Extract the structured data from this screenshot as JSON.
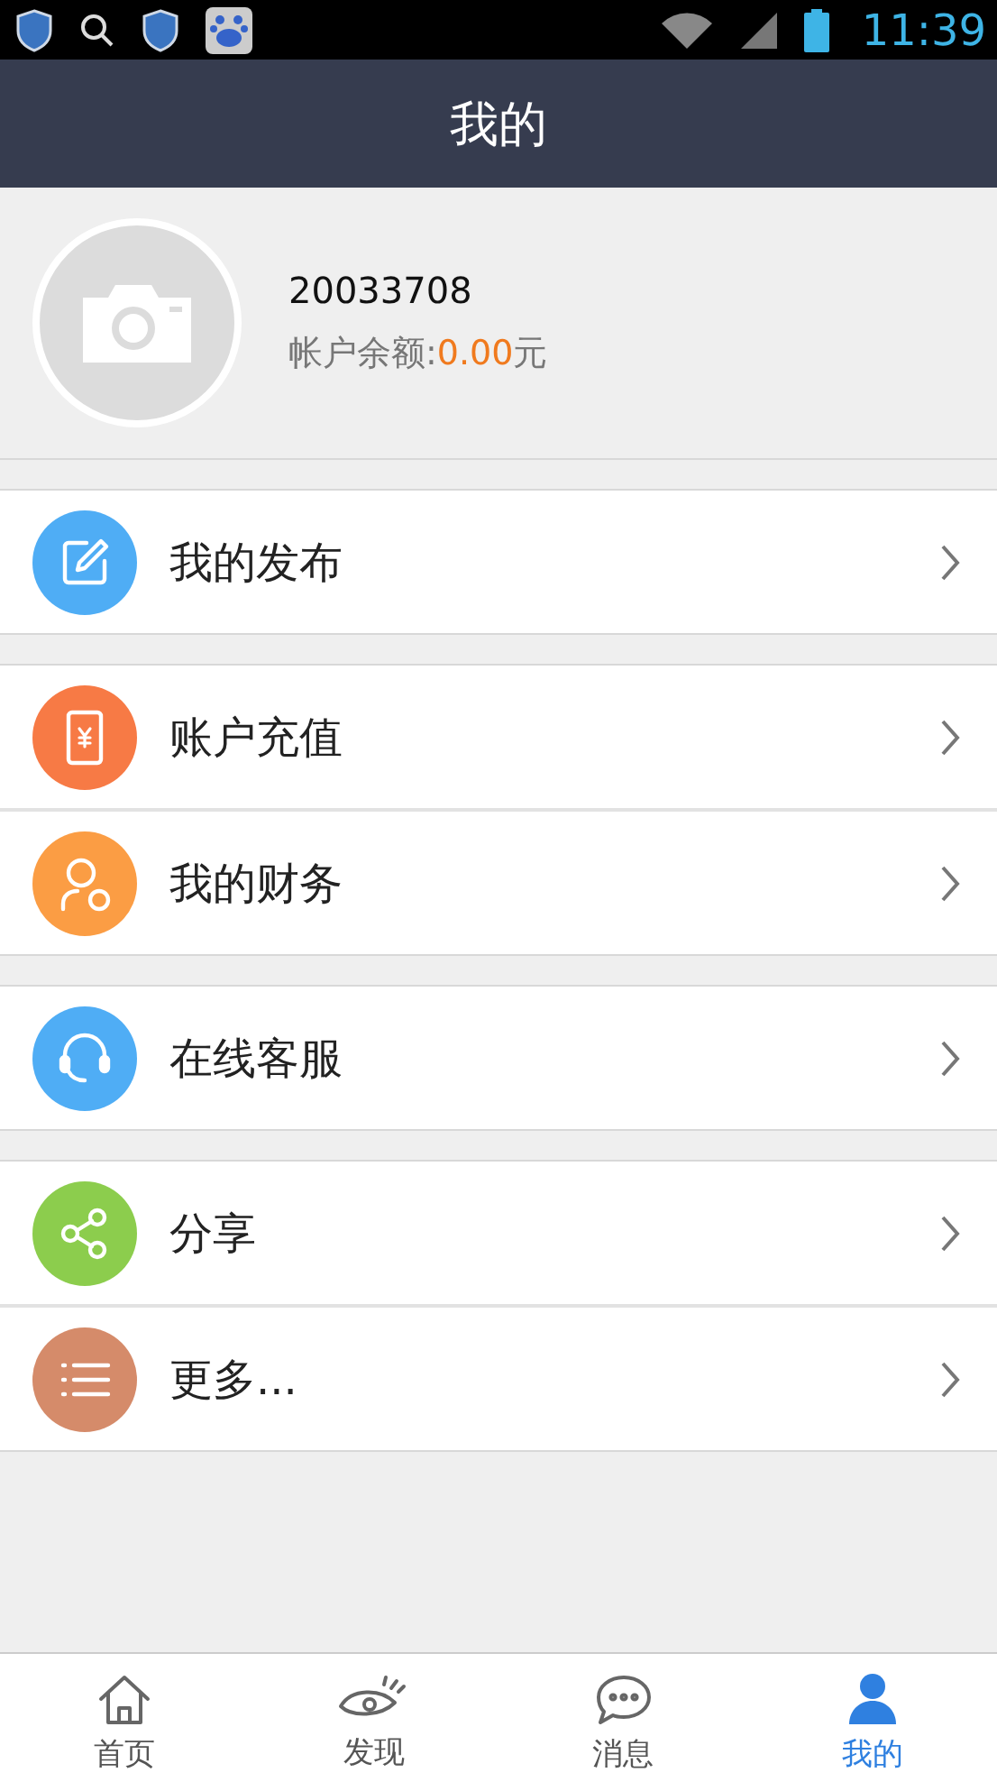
{
  "status_bar": {
    "time": "11:39"
  },
  "header": {
    "title": "我的"
  },
  "profile": {
    "user_id": "20033708",
    "balance_label": "帐户余额:",
    "balance_value": "0.00",
    "balance_unit": "元"
  },
  "menu_groups": [
    {
      "items": [
        {
          "label": "我的发布",
          "kind": "edit",
          "color": "#4fadf5"
        }
      ]
    },
    {
      "items": [
        {
          "label": "账户充值",
          "kind": "recharge",
          "color": "#f77a45"
        },
        {
          "label": "我的财务",
          "kind": "finance",
          "color": "#fb9d44"
        }
      ]
    },
    {
      "items": [
        {
          "label": "在线客服",
          "kind": "headset",
          "color": "#4fadf5"
        }
      ]
    },
    {
      "items": [
        {
          "label": "分享",
          "kind": "share",
          "color": "#8ccd4d"
        },
        {
          "label": "更多...",
          "kind": "list",
          "color": "#d58b6a"
        }
      ]
    }
  ],
  "tab_bar": [
    {
      "label": "首页",
      "kind": "home",
      "selected": false
    },
    {
      "label": "发现",
      "kind": "eye",
      "selected": false
    },
    {
      "label": "消息",
      "kind": "chat",
      "selected": false
    },
    {
      "label": "我的",
      "kind": "person",
      "selected": true
    }
  ]
}
